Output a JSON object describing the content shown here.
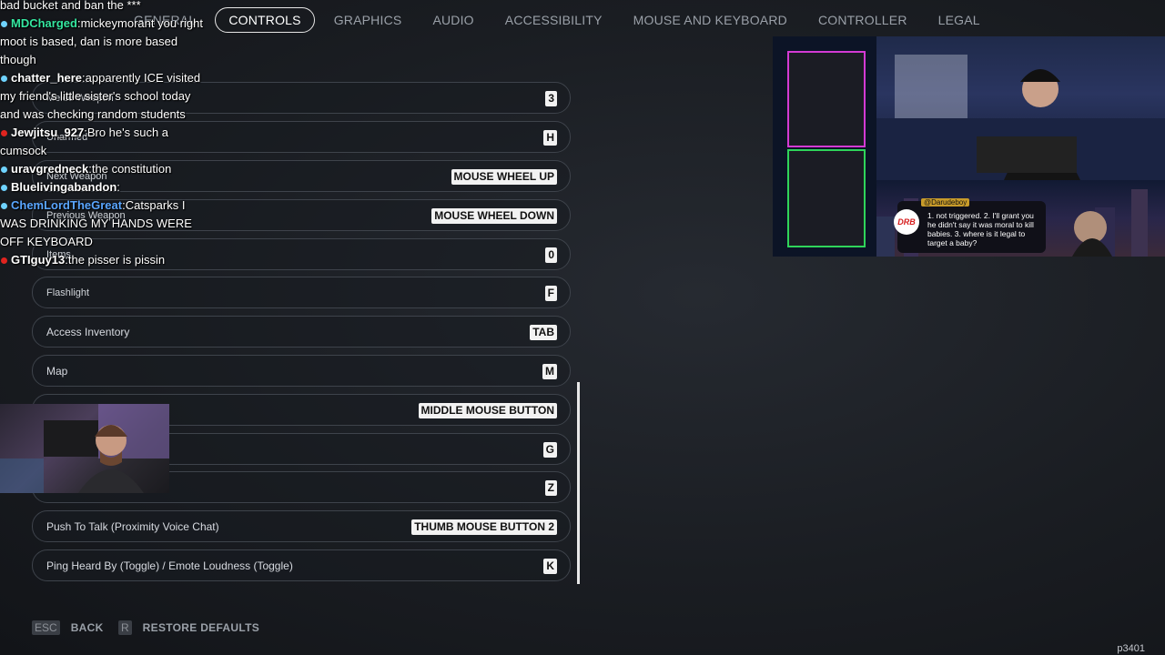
{
  "tabs": [
    {
      "label": "GENERAL",
      "active": false
    },
    {
      "label": "CONTROLS",
      "active": true
    },
    {
      "label": "GRAPHICS",
      "active": false
    },
    {
      "label": "AUDIO",
      "active": false
    },
    {
      "label": "ACCESSIBILITY",
      "active": false
    },
    {
      "label": "MOUSE AND KEYBOARD",
      "active": false
    },
    {
      "label": "CONTROLLER",
      "active": false
    },
    {
      "label": "LEGAL",
      "active": false
    }
  ],
  "bindings": [
    {
      "label": "Melee Weapon",
      "key": "3"
    },
    {
      "label": "Unarmed",
      "key": "H"
    },
    {
      "label": "Next Weapon",
      "key": "MOUSE WHEEL UP"
    },
    {
      "label": "Previous Weapon",
      "key": "MOUSE WHEEL DOWN"
    },
    {
      "label": "Items",
      "key": "0"
    },
    {
      "label": "Flashlight",
      "key": "F"
    },
    {
      "label": "Access Inventory",
      "key": "TAB"
    },
    {
      "label": "Map",
      "key": "M"
    },
    {
      "label": "",
      "key": "MIDDLE MOUSE BUTTON"
    },
    {
      "label": "",
      "key": "G"
    },
    {
      "label": "",
      "key": "Z"
    },
    {
      "label": "Push To Talk (Proximity Voice Chat)",
      "key": "THUMB MOUSE BUTTON 2"
    },
    {
      "label": "Ping Heard By (Toggle) / Emote Loudness (Toggle)",
      "key": "K"
    }
  ],
  "footer": {
    "back_key": "ESC",
    "back_label": "BACK",
    "restore_key": "R",
    "restore_label": "RESTORE DEFAULTS",
    "code": "p3401"
  },
  "chat": [
    {
      "user": "",
      "text": "bad bucket and ban the ***",
      "color": "#ffffff"
    },
    {
      "user": "MDCharged",
      "text": "mickeymorant you right moot is based, dan is more based though",
      "color": "#35e6a0",
      "dot": "#6fd3ff"
    },
    {
      "user": "chatter_here",
      "text": "apparently ICE visited my friend's little sister's school today and was checking random students",
      "color": "#ffffff",
      "dot": "#6fd3ff"
    },
    {
      "user": "Jewjitsu_927",
      "text": "Bro he's such a cumsock",
      "color": "#ffffff",
      "dot": "#e0241f"
    },
    {
      "user": "uravgredneck",
      "text": "the constitution",
      "color": "#ffffff",
      "dot": "#6fd3ff"
    },
    {
      "user": "Bluelivingabandon",
      "text": "",
      "color": "#ffffff",
      "dot": "#6fd3ff"
    },
    {
      "user": "ChemLordTheGreat",
      "text": "Catsparks I WAS DRINKING MY HANDS WERE OFF KEYBOARD",
      "color": "#5aa6ff",
      "dot": "#6fd3ff"
    },
    {
      "user": "GTIguy13",
      "text": "the pisser is pissin",
      "color": "#ffffff",
      "dot": "#e0241f"
    }
  ],
  "stream": {
    "handle": "@Darudeboy",
    "logo": "DRB",
    "bubble_text": "1. not triggered. 2. I'll grant you he didn't say it was moral to kill babies. 3. where is it legal to target a baby?"
  }
}
